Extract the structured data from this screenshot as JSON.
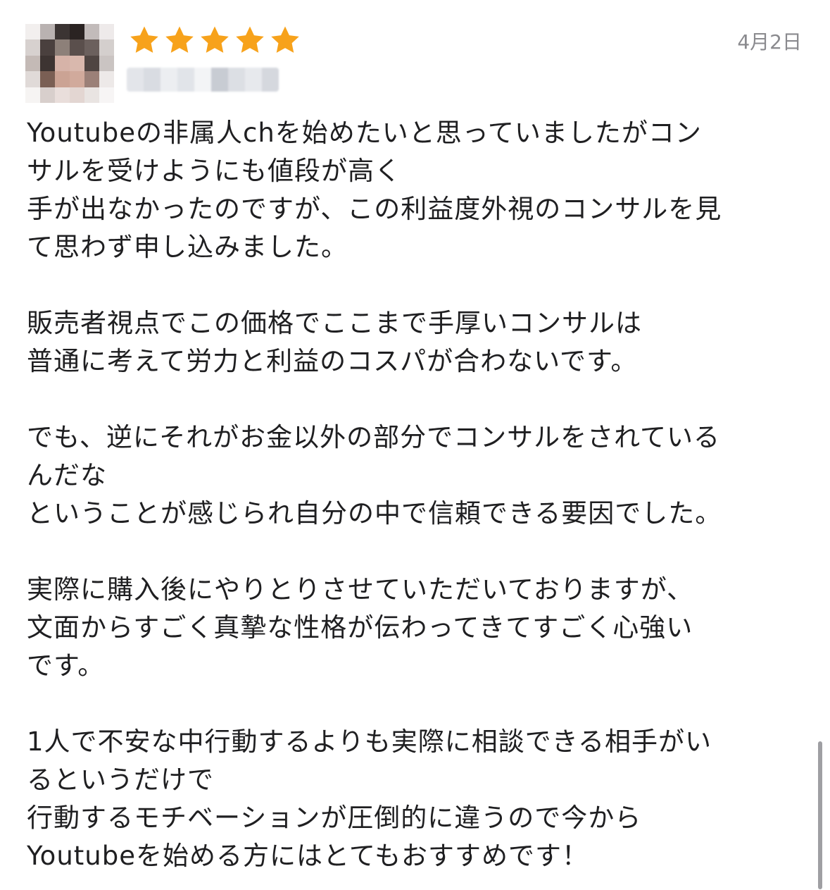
{
  "review": {
    "rating": 5,
    "max_rating": 5,
    "date": "4月2日",
    "star_color": "#f7a21b",
    "avatar_icon": "blurred-user-avatar",
    "lines": [
      "Youtubeの非属人chを始めたいと思っていましたがコン",
      "サルを受けようにも値段が高く",
      "手が出なかったのですが、この利益度外視のコンサルを見",
      "て思わず申し込みました。",
      "",
      "販売者視点でこの価格でここまで手厚いコンサルは",
      "普通に考えて労力と利益のコスパが合わないです。",
      "",
      "でも、逆にそれがお金以外の部分でコンサルをされている",
      "んだな",
      "ということが感じられ自分の中で信頼できる要因でした。",
      "",
      "実際に購入後にやりとりさせていただいておりますが、",
      "文面からすごく真摯な性格が伝わってきてすごく心強い",
      "です。",
      "",
      "1人で不安な中行動するよりも実際に相談できる相手がい",
      "るというだけで",
      "行動するモチベーションが圧倒的に違うので今から",
      "Youtubeを始める方にはとてもおすすめです！"
    ]
  }
}
